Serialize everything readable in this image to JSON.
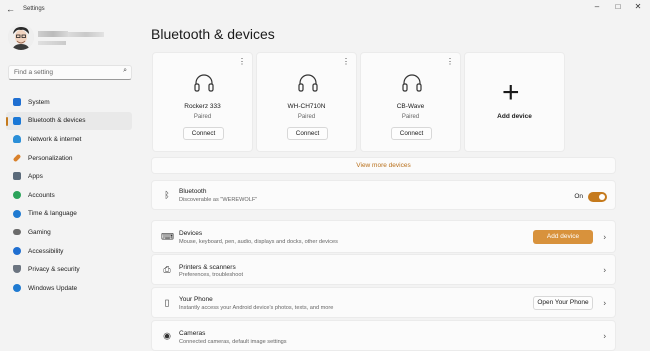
{
  "window": {
    "title": "Settings"
  },
  "sidebar": {
    "search_placeholder": "Find a setting",
    "items": [
      {
        "label": "System",
        "icon": "monitor-icon",
        "color": "#1f6fd1"
      },
      {
        "label": "Bluetooth & devices",
        "icon": "bluetooth-icon",
        "color": "#1b78d6",
        "active": true
      },
      {
        "label": "Network & internet",
        "icon": "wifi-icon",
        "color": "#2b8fd8"
      },
      {
        "label": "Personalization",
        "icon": "paintbrush-icon",
        "color": "#d9812b"
      },
      {
        "label": "Apps",
        "icon": "apps-icon",
        "color": "#5b6a7a"
      },
      {
        "label": "Accounts",
        "icon": "person-icon",
        "color": "#2ba35a"
      },
      {
        "label": "Time & language",
        "icon": "globe-clock-icon",
        "color": "#1f7ad1"
      },
      {
        "label": "Gaming",
        "icon": "gamepad-icon",
        "color": "#6b6b6b"
      },
      {
        "label": "Accessibility",
        "icon": "accessibility-icon",
        "color": "#1f6fd1"
      },
      {
        "label": "Privacy & security",
        "icon": "shield-icon",
        "color": "#6b7480"
      },
      {
        "label": "Windows Update",
        "icon": "windows-update-icon",
        "color": "#1f7ad1"
      }
    ]
  },
  "main": {
    "title": "Bluetooth & devices",
    "devices": [
      {
        "name": "Rockerz 333",
        "status": "Paired",
        "button": "Connect"
      },
      {
        "name": "WH-CH710N",
        "status": "Paired",
        "button": "Connect"
      },
      {
        "name": "CB-Wave",
        "status": "Paired",
        "button": "Connect"
      }
    ],
    "add_device_card": "Add device",
    "view_more": "View more devices",
    "bluetooth": {
      "title": "Bluetooth",
      "subtitle": "Discoverable as \"WEREWOLF\"",
      "state": "On"
    },
    "rows": [
      {
        "title": "Devices",
        "subtitle": "Mouse, keyboard, pen, audio, displays and docks, other devices",
        "button": "Add device",
        "icon": "keyboard-icon"
      },
      {
        "title": "Printers & scanners",
        "subtitle": "Preferences, troubleshoot",
        "icon": "printer-icon"
      },
      {
        "title": "Your Phone",
        "subtitle": "Instantly access your Android device's photos, texts, and more",
        "button": "Open Your Phone",
        "icon": "phone-icon"
      },
      {
        "title": "Cameras",
        "subtitle": "Connected cameras, default image settings",
        "icon": "camera-icon"
      }
    ]
  },
  "colors": {
    "accent": "#c57a1d",
    "accent_button": "#d8923c",
    "link": "#b86f1a"
  }
}
